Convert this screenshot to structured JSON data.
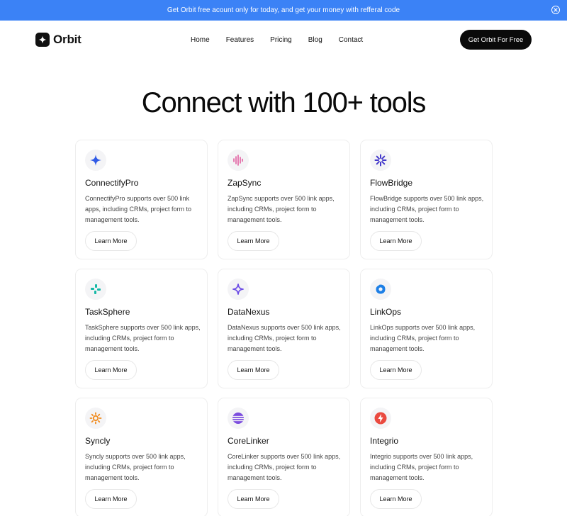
{
  "banner": {
    "text": "Get Orbit free acount only for today, and get your money with refferal code",
    "close_icon": "close-circle-icon"
  },
  "nav": {
    "logo_icon": "sparkle-icon",
    "logo_text": "Orbit",
    "links": [
      "Home",
      "Features",
      "Pricing",
      "Blog",
      "Contact"
    ],
    "cta_label": "Get Orbit For Free"
  },
  "hero": {
    "title": "Connect with 100+ tools"
  },
  "cards": [
    {
      "icon": "four-point-star-icon",
      "icon_color": "#2f5ae6",
      "title": "ConnectifyPro",
      "description": "ConnectifyPro supports over 500 link apps, including CRMs, project form to management tools.",
      "button": "Learn More"
    },
    {
      "icon": "waveform-icon",
      "icon_color": "#e0559a",
      "title": "ZapSync",
      "description": "ZapSync supports over 500 link apps, including CRMs, project form to management tools.",
      "button": "Learn More"
    },
    {
      "icon": "burst-icon",
      "icon_color": "#4338ca",
      "title": "FlowBridge",
      "description": "FlowBridge supports over 500 link apps, including CRMs, project form to management tools.",
      "button": "Learn More"
    },
    {
      "icon": "pinwheel-icon",
      "icon_color": "#14b8a6",
      "title": "TaskSphere",
      "description": "TaskSphere supports over 500 link apps, including CRMs, project form to management tools.",
      "button": "Learn More"
    },
    {
      "icon": "outline-star-icon",
      "icon_color": "#6d4de6",
      "title": "DataNexus",
      "description": "DataNexus supports over 500 link apps, including CRMs, project form to management tools.",
      "button": "Learn More"
    },
    {
      "icon": "blob-ring-icon",
      "icon_color": "#1d7fe6",
      "title": "LinkOps",
      "description": "LinkOps supports over 500 link apps, including CRMs, project form to management tools.",
      "button": "Learn More"
    },
    {
      "icon": "sun-icon",
      "icon_color": "#f08a1c",
      "title": "Syncly",
      "description": "Syncly supports over 500 link apps, including CRMs, project form to management tools.",
      "button": "Learn More"
    },
    {
      "icon": "striped-sphere-icon",
      "icon_color": "#7c4dde",
      "title": "CoreLinker",
      "description": "CoreLinker supports over 500 link apps, including CRMs, project form to management tools.",
      "button": "Learn More"
    },
    {
      "icon": "lightning-bolt-icon",
      "icon_color": "#ea4a40",
      "title": "Integrio",
      "description": "Integrio supports over 500 link apps, including CRMs, project form to management tools.",
      "button": "Learn More"
    }
  ]
}
